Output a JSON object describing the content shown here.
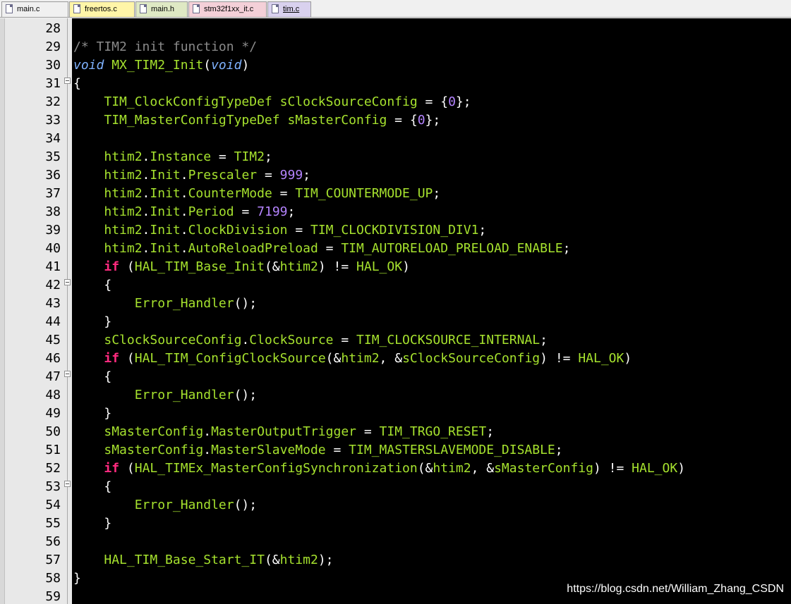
{
  "tabs": [
    {
      "label": "main.c",
      "color": "#f0f0f0",
      "active": false
    },
    {
      "label": "freertos.c",
      "color": "#fff5a8",
      "active": false
    },
    {
      "label": "main.h",
      "color": "#dfe9c4",
      "active": false
    },
    {
      "label": "stm32f1xx_it.c",
      "color": "#f4d0d8",
      "active": false
    },
    {
      "label": "tim.c",
      "color": "#d9d1ee",
      "active": true
    }
  ],
  "lines": [
    {
      "num": "28",
      "fold": false,
      "tokens": []
    },
    {
      "num": "29",
      "fold": false,
      "tokens": [
        {
          "t": "/* TIM2 init function */",
          "c": "comment"
        }
      ]
    },
    {
      "num": "30",
      "fold": false,
      "tokens": [
        {
          "t": "void",
          "c": "type"
        },
        {
          "t": " ",
          "c": "punct"
        },
        {
          "t": "MX_TIM2_Init",
          "c": "func"
        },
        {
          "t": "(",
          "c": "punct"
        },
        {
          "t": "void",
          "c": "type"
        },
        {
          "t": ")",
          "c": "punct"
        }
      ]
    },
    {
      "num": "31",
      "fold": true,
      "tokens": [
        {
          "t": "{",
          "c": "punct"
        }
      ]
    },
    {
      "num": "32",
      "fold": false,
      "tokens": [
        {
          "t": "    ",
          "c": "punct"
        },
        {
          "t": "TIM_ClockConfigTypeDef",
          "c": "ident"
        },
        {
          "t": " ",
          "c": "punct"
        },
        {
          "t": "sClockSourceConfig",
          "c": "ident"
        },
        {
          "t": " = {",
          "c": "punct"
        },
        {
          "t": "0",
          "c": "number"
        },
        {
          "t": "};",
          "c": "punct"
        }
      ]
    },
    {
      "num": "33",
      "fold": false,
      "tokens": [
        {
          "t": "    ",
          "c": "punct"
        },
        {
          "t": "TIM_MasterConfigTypeDef",
          "c": "ident"
        },
        {
          "t": " ",
          "c": "punct"
        },
        {
          "t": "sMasterConfig",
          "c": "ident"
        },
        {
          "t": " = {",
          "c": "punct"
        },
        {
          "t": "0",
          "c": "number"
        },
        {
          "t": "};",
          "c": "punct"
        }
      ]
    },
    {
      "num": "34",
      "fold": false,
      "tokens": []
    },
    {
      "num": "35",
      "fold": false,
      "tokens": [
        {
          "t": "    ",
          "c": "punct"
        },
        {
          "t": "htim2",
          "c": "ident"
        },
        {
          "t": ".",
          "c": "punct"
        },
        {
          "t": "Instance",
          "c": "ident"
        },
        {
          "t": " = ",
          "c": "punct"
        },
        {
          "t": "TIM2",
          "c": "ident"
        },
        {
          "t": ";",
          "c": "punct"
        }
      ]
    },
    {
      "num": "36",
      "fold": false,
      "tokens": [
        {
          "t": "    ",
          "c": "punct"
        },
        {
          "t": "htim2",
          "c": "ident"
        },
        {
          "t": ".",
          "c": "punct"
        },
        {
          "t": "Init",
          "c": "ident"
        },
        {
          "t": ".",
          "c": "punct"
        },
        {
          "t": "Prescaler",
          "c": "ident"
        },
        {
          "t": " = ",
          "c": "punct"
        },
        {
          "t": "999",
          "c": "number"
        },
        {
          "t": ";",
          "c": "punct"
        }
      ]
    },
    {
      "num": "37",
      "fold": false,
      "tokens": [
        {
          "t": "    ",
          "c": "punct"
        },
        {
          "t": "htim2",
          "c": "ident"
        },
        {
          "t": ".",
          "c": "punct"
        },
        {
          "t": "Init",
          "c": "ident"
        },
        {
          "t": ".",
          "c": "punct"
        },
        {
          "t": "CounterMode",
          "c": "ident"
        },
        {
          "t": " = ",
          "c": "punct"
        },
        {
          "t": "TIM_COUNTERMODE_UP",
          "c": "ident"
        },
        {
          "t": ";",
          "c": "punct"
        }
      ]
    },
    {
      "num": "38",
      "fold": false,
      "tokens": [
        {
          "t": "    ",
          "c": "punct"
        },
        {
          "t": "htim2",
          "c": "ident"
        },
        {
          "t": ".",
          "c": "punct"
        },
        {
          "t": "Init",
          "c": "ident"
        },
        {
          "t": ".",
          "c": "punct"
        },
        {
          "t": "Period",
          "c": "ident"
        },
        {
          "t": " = ",
          "c": "punct"
        },
        {
          "t": "7199",
          "c": "number"
        },
        {
          "t": ";",
          "c": "punct"
        }
      ]
    },
    {
      "num": "39",
      "fold": false,
      "tokens": [
        {
          "t": "    ",
          "c": "punct"
        },
        {
          "t": "htim2",
          "c": "ident"
        },
        {
          "t": ".",
          "c": "punct"
        },
        {
          "t": "Init",
          "c": "ident"
        },
        {
          "t": ".",
          "c": "punct"
        },
        {
          "t": "ClockDivision",
          "c": "ident"
        },
        {
          "t": " = ",
          "c": "punct"
        },
        {
          "t": "TIM_CLOCKDIVISION_DIV1",
          "c": "ident"
        },
        {
          "t": ";",
          "c": "punct"
        }
      ]
    },
    {
      "num": "40",
      "fold": false,
      "tokens": [
        {
          "t": "    ",
          "c": "punct"
        },
        {
          "t": "htim2",
          "c": "ident"
        },
        {
          "t": ".",
          "c": "punct"
        },
        {
          "t": "Init",
          "c": "ident"
        },
        {
          "t": ".",
          "c": "punct"
        },
        {
          "t": "AutoReloadPreload",
          "c": "ident"
        },
        {
          "t": " = ",
          "c": "punct"
        },
        {
          "t": "TIM_AUTORELOAD_PRELOAD_ENABLE",
          "c": "ident"
        },
        {
          "t": ";",
          "c": "punct"
        }
      ]
    },
    {
      "num": "41",
      "fold": false,
      "tokens": [
        {
          "t": "    ",
          "c": "punct"
        },
        {
          "t": "if",
          "c": "keyword"
        },
        {
          "t": " (",
          "c": "punct"
        },
        {
          "t": "HAL_TIM_Base_Init",
          "c": "func"
        },
        {
          "t": "(&",
          "c": "punct"
        },
        {
          "t": "htim2",
          "c": "ident"
        },
        {
          "t": ") != ",
          "c": "punct"
        },
        {
          "t": "HAL_OK",
          "c": "ident"
        },
        {
          "t": ")",
          "c": "punct"
        }
      ]
    },
    {
      "num": "42",
      "fold": true,
      "tokens": [
        {
          "t": "    {",
          "c": "punct"
        }
      ]
    },
    {
      "num": "43",
      "fold": false,
      "tokens": [
        {
          "t": "        ",
          "c": "punct"
        },
        {
          "t": "Error_Handler",
          "c": "func"
        },
        {
          "t": "();",
          "c": "punct"
        }
      ]
    },
    {
      "num": "44",
      "fold": false,
      "tokens": [
        {
          "t": "    }",
          "c": "punct"
        }
      ]
    },
    {
      "num": "45",
      "fold": false,
      "tokens": [
        {
          "t": "    ",
          "c": "punct"
        },
        {
          "t": "sClockSourceConfig",
          "c": "ident"
        },
        {
          "t": ".",
          "c": "punct"
        },
        {
          "t": "ClockSource",
          "c": "ident"
        },
        {
          "t": " = ",
          "c": "punct"
        },
        {
          "t": "TIM_CLOCKSOURCE_INTERNAL",
          "c": "ident"
        },
        {
          "t": ";",
          "c": "punct"
        }
      ]
    },
    {
      "num": "46",
      "fold": false,
      "tokens": [
        {
          "t": "    ",
          "c": "punct"
        },
        {
          "t": "if",
          "c": "keyword"
        },
        {
          "t": " (",
          "c": "punct"
        },
        {
          "t": "HAL_TIM_ConfigClockSource",
          "c": "func"
        },
        {
          "t": "(&",
          "c": "punct"
        },
        {
          "t": "htim2",
          "c": "ident"
        },
        {
          "t": ", &",
          "c": "punct"
        },
        {
          "t": "sClockSourceConfig",
          "c": "ident"
        },
        {
          "t": ") != ",
          "c": "punct"
        },
        {
          "t": "HAL_OK",
          "c": "ident"
        },
        {
          "t": ")",
          "c": "punct"
        }
      ]
    },
    {
      "num": "47",
      "fold": true,
      "tokens": [
        {
          "t": "    {",
          "c": "punct"
        }
      ]
    },
    {
      "num": "48",
      "fold": false,
      "tokens": [
        {
          "t": "        ",
          "c": "punct"
        },
        {
          "t": "Error_Handler",
          "c": "func"
        },
        {
          "t": "();",
          "c": "punct"
        }
      ]
    },
    {
      "num": "49",
      "fold": false,
      "tokens": [
        {
          "t": "    }",
          "c": "punct"
        }
      ]
    },
    {
      "num": "50",
      "fold": false,
      "tokens": [
        {
          "t": "    ",
          "c": "punct"
        },
        {
          "t": "sMasterConfig",
          "c": "ident"
        },
        {
          "t": ".",
          "c": "punct"
        },
        {
          "t": "MasterOutputTrigger",
          "c": "ident"
        },
        {
          "t": " = ",
          "c": "punct"
        },
        {
          "t": "TIM_TRGO_RESET",
          "c": "ident"
        },
        {
          "t": ";",
          "c": "punct"
        }
      ]
    },
    {
      "num": "51",
      "fold": false,
      "tokens": [
        {
          "t": "    ",
          "c": "punct"
        },
        {
          "t": "sMasterConfig",
          "c": "ident"
        },
        {
          "t": ".",
          "c": "punct"
        },
        {
          "t": "MasterSlaveMode",
          "c": "ident"
        },
        {
          "t": " = ",
          "c": "punct"
        },
        {
          "t": "TIM_MASTERSLAVEMODE_DISABLE",
          "c": "ident"
        },
        {
          "t": ";",
          "c": "punct"
        }
      ]
    },
    {
      "num": "52",
      "fold": false,
      "tokens": [
        {
          "t": "    ",
          "c": "punct"
        },
        {
          "t": "if",
          "c": "keyword"
        },
        {
          "t": " (",
          "c": "punct"
        },
        {
          "t": "HAL_TIMEx_MasterConfigSynchronization",
          "c": "func"
        },
        {
          "t": "(&",
          "c": "punct"
        },
        {
          "t": "htim2",
          "c": "ident"
        },
        {
          "t": ", &",
          "c": "punct"
        },
        {
          "t": "sMasterConfig",
          "c": "ident"
        },
        {
          "t": ") != ",
          "c": "punct"
        },
        {
          "t": "HAL_OK",
          "c": "ident"
        },
        {
          "t": ")",
          "c": "punct"
        }
      ]
    },
    {
      "num": "53",
      "fold": true,
      "tokens": [
        {
          "t": "    {",
          "c": "punct"
        }
      ]
    },
    {
      "num": "54",
      "fold": false,
      "tokens": [
        {
          "t": "        ",
          "c": "punct"
        },
        {
          "t": "Error_Handler",
          "c": "func"
        },
        {
          "t": "();",
          "c": "punct"
        }
      ]
    },
    {
      "num": "55",
      "fold": false,
      "tokens": [
        {
          "t": "    }",
          "c": "punct"
        }
      ]
    },
    {
      "num": "56",
      "fold": false,
      "tokens": []
    },
    {
      "num": "57",
      "fold": false,
      "tokens": [
        {
          "t": "    ",
          "c": "punct"
        },
        {
          "t": "HAL_TIM_Base_Start_IT",
          "c": "func"
        },
        {
          "t": "(&",
          "c": "punct"
        },
        {
          "t": "htim2",
          "c": "ident"
        },
        {
          "t": ");",
          "c": "punct"
        }
      ]
    },
    {
      "num": "58",
      "fold": false,
      "tokens": [
        {
          "t": "}",
          "c": "punct"
        }
      ]
    },
    {
      "num": "59",
      "fold": false,
      "tokens": []
    }
  ],
  "watermark": "https://blog.csdn.net/William_Zhang_CSDN"
}
